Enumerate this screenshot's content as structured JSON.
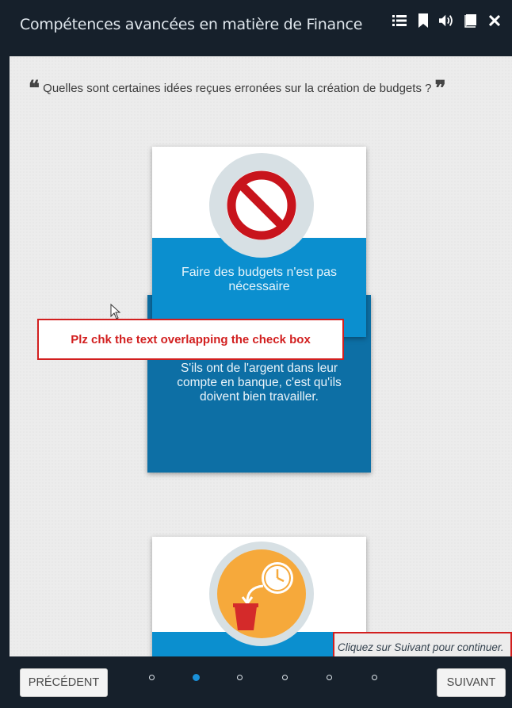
{
  "header": {
    "title": "Compétences avancées en matière de Finance",
    "icons": [
      "list-icon",
      "bookmark-icon",
      "volume-icon",
      "book-icon",
      "close-icon"
    ]
  },
  "question": {
    "open_quote": "❝",
    "text": "Quelles sont certaines idées reçues erronées sur la création de budgets ?",
    "close_quote": "❞"
  },
  "cards": [
    {
      "icon": "prohibited-icon",
      "label": "Faire des budgets n'est pas nécessaire",
      "back_text": "S'ils ont de l'argent dans leur compte en banque, c'est qu'ils doivent bien travailler."
    },
    {
      "icon": "clock-trash-icon"
    }
  ],
  "annotation": {
    "text": "Plz chk the text overlapping the check box"
  },
  "hint": {
    "text": "Cliquez sur Suivant pour continuer."
  },
  "footer": {
    "prev_label": "PRÉCÉDENT",
    "next_label": "SUIVANT",
    "page_count": 6,
    "active_page": 2
  },
  "colors": {
    "header_bg": "#16202b",
    "card_band": "#0b8fcf",
    "card_back": "#0d6fa5",
    "annotation_red": "#d21f1f",
    "active_dot": "#1a90d8"
  }
}
